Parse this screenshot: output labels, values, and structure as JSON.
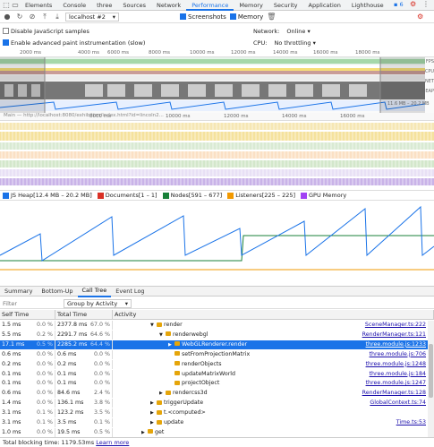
{
  "devtools_tabs": [
    "Elements",
    "Console",
    "three",
    "Sources",
    "Network",
    "Performance",
    "Memory",
    "Security",
    "Application",
    "Lighthouse"
  ],
  "active_tab_index": 5,
  "badge_count": "6",
  "target_select": "localhost #2",
  "screenshots_label": "Screenshots",
  "memory_label": "Memory",
  "disable_js_samples_label": "Disable JavaScript samples",
  "advanced_paint_label": "Enable advanced paint instrumentation (slow)",
  "network_label": "Network:",
  "network_value": "Online",
  "cpu_label": "CPU:",
  "cpu_value": "No throttling",
  "overview_ticks": [
    "2000 ms",
    "4000 ms",
    "6000 ms",
    "8000 ms",
    "10000 ms",
    "12000 ms",
    "14000 ms",
    "16000 ms",
    "18000 ms"
  ],
  "overview_side_labels": [
    "FPS",
    "CPU",
    "NET",
    "HEAP"
  ],
  "heap_range_label": "11.6 MB – 20.2 MB",
  "main_ticks": [
    "8000 ms",
    "10000 ms",
    "12000 ms",
    "14000 ms",
    "16000 ms"
  ],
  "main_thread_label": "Main — http://localhost:8080/exhibition/index.html?id=lincoln2...",
  "legend": [
    {
      "label": "JS Heap[12.4 MB – 20.2 MB]",
      "color": "#1a73e8",
      "checked": true
    },
    {
      "label": "Documents[1 – 1]",
      "color": "#d93025",
      "checked": true
    },
    {
      "label": "Nodes[591 – 677]",
      "color": "#188038",
      "checked": true
    },
    {
      "label": "Listeners[225 – 225]",
      "color": "#f29900",
      "checked": true
    },
    {
      "label": "GPU Memory",
      "color": "#a142f4",
      "checked": true
    }
  ],
  "bottom_tabs": [
    "Summary",
    "Bottom-Up",
    "Call Tree",
    "Event Log"
  ],
  "active_bottom_tab": 2,
  "filter_placeholder": "Filter",
  "group_by": "Group by Activity",
  "table_headers": {
    "self": "Self Time",
    "total": "Total Time",
    "activity": "Activity"
  },
  "rows": [
    {
      "self": "1.5 ms",
      "selfPct": "0.0 %",
      "total": "2377.8 ms",
      "totalPct": "67.0 %",
      "indent": 4,
      "name": "render",
      "src": "SceneManager.ts:222",
      "folder": true,
      "arrow": "▼"
    },
    {
      "self": "5.5 ms",
      "selfPct": "0.2 %",
      "total": "2291.7 ms",
      "totalPct": "64.6 %",
      "indent": 5,
      "name": "renderwebgl",
      "src": "RenderManager.ts:121",
      "folder": true,
      "arrow": "▼"
    },
    {
      "self": "17.1 ms",
      "selfPct": "0.5 %",
      "total": "2285.2 ms",
      "totalPct": "64.4 %",
      "indent": 6,
      "name": "WebGLRenderer.render",
      "src": "three.module.js:1233",
      "folder": true,
      "arrow": "▶",
      "selected": true
    },
    {
      "self": "0.6 ms",
      "selfPct": "0.0 %",
      "total": "0.6 ms",
      "totalPct": "0.0 %",
      "indent": 6,
      "name": "setFromProjectionMatrix",
      "src": "three.module.js:706",
      "folder": true,
      "arrow": ""
    },
    {
      "self": "0.2 ms",
      "selfPct": "0.0 %",
      "total": "0.2 ms",
      "totalPct": "0.0 %",
      "indent": 6,
      "name": "renderObjects",
      "src": "three.module.js:1248",
      "folder": true,
      "arrow": ""
    },
    {
      "self": "0.1 ms",
      "selfPct": "0.0 %",
      "total": "0.1 ms",
      "totalPct": "0.0 %",
      "indent": 6,
      "name": "updateMatrixWorld",
      "src": "three.module.js:184",
      "folder": true,
      "arrow": ""
    },
    {
      "self": "0.1 ms",
      "selfPct": "0.0 %",
      "total": "0.1 ms",
      "totalPct": "0.0 %",
      "indent": 6,
      "name": "projectObject",
      "src": "three.module.js:1247",
      "folder": true,
      "arrow": ""
    },
    {
      "self": "0.6 ms",
      "selfPct": "0.0 %",
      "total": "84.6 ms",
      "totalPct": "2.4 %",
      "indent": 5,
      "name": "rendercss3d",
      "src": "RenderManager.ts:128",
      "folder": true,
      "arrow": "▶"
    },
    {
      "self": "1.4 ms",
      "selfPct": "0.0 %",
      "total": "136.1 ms",
      "totalPct": "3.8 %",
      "indent": 4,
      "name": "triggerUpdate",
      "src": "GlobalContext.ts:74",
      "folder": true,
      "arrow": "▶"
    },
    {
      "self": "3.1 ms",
      "selfPct": "0.1 %",
      "total": "123.2 ms",
      "totalPct": "3.5 %",
      "indent": 4,
      "name": "t.<computed>",
      "src": "",
      "folder": true,
      "arrow": "▶"
    },
    {
      "self": "3.1 ms",
      "selfPct": "0.1 %",
      "total": "3.5 ms",
      "totalPct": "0.1 %",
      "indent": 4,
      "name": "update",
      "src": "Time.ts:53",
      "folder": true,
      "arrow": "▶"
    },
    {
      "self": "1.0 ms",
      "selfPct": "0.0 %",
      "total": "19.5 ms",
      "totalPct": "0.5 %",
      "indent": 3,
      "name": "get",
      "src": "",
      "folder": true,
      "arrow": "▶"
    }
  ],
  "status_text": "Total blocking time: 1179.53ms",
  "learn_more": "Learn more"
}
